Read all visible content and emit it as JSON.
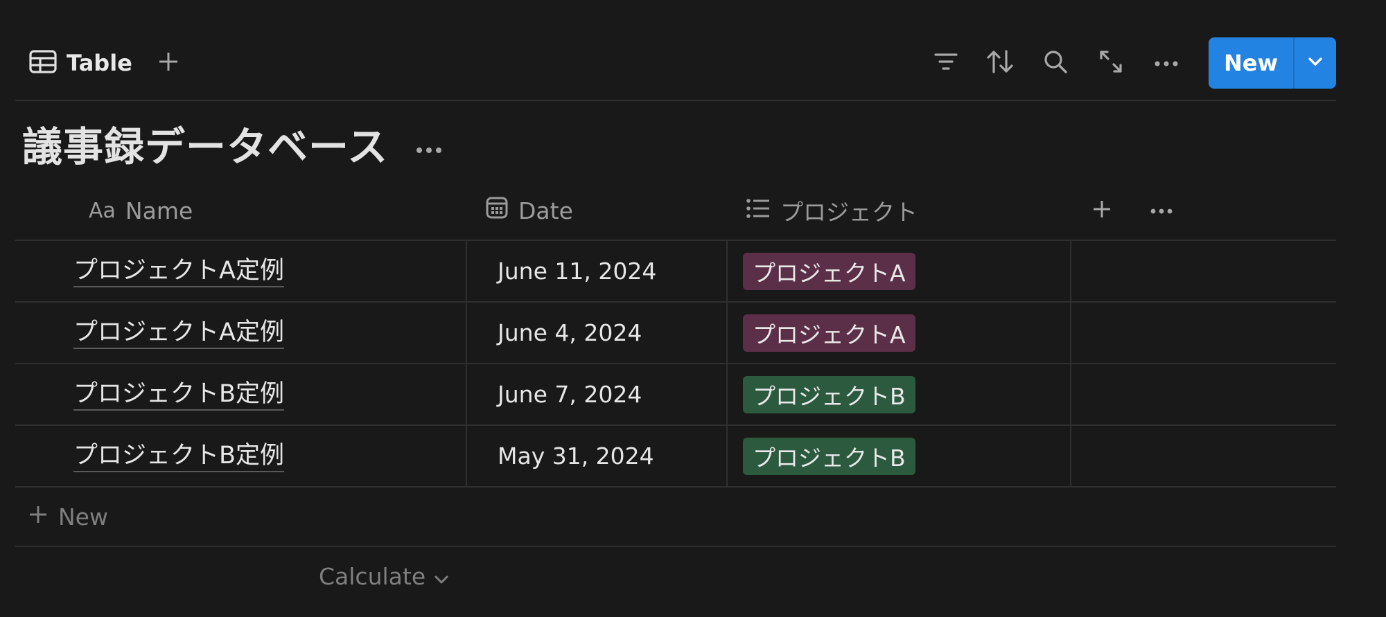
{
  "toolbar": {
    "view_tab_label": "Table",
    "new_button_label": "New"
  },
  "database": {
    "title": "議事録データベース"
  },
  "table": {
    "columns": {
      "name": {
        "prefix": "Aa",
        "label": "Name"
      },
      "date": {
        "label": "Date"
      },
      "project": {
        "label": "プロジェクト"
      }
    },
    "rows": [
      {
        "name": "プロジェクトA定例",
        "date": "June 11, 2024",
        "project": "プロジェクトA"
      },
      {
        "name": "プロジェクトA定例",
        "date": "June 4, 2024",
        "project": "プロジェクトA"
      },
      {
        "name": "プロジェクトB定例",
        "date": "June 7, 2024",
        "project": "プロジェクトB"
      },
      {
        "name": "プロジェクトB定例",
        "date": "May 31, 2024",
        "project": "プロジェクトB"
      }
    ],
    "add_row_label": "New",
    "calculate_label": "Calculate"
  },
  "colors": {
    "background": "#191919",
    "accent": "#2383e2",
    "tag_project_a": "#5c2f48",
    "tag_project_b": "#2b5a3e",
    "border": "#2f2f2f"
  },
  "icons": {
    "view": "table-icon",
    "add_view": "plus-icon",
    "filter": "filter-icon",
    "sort": "sort-icon",
    "search": "search-icon",
    "expand": "expand-icon",
    "more": "more-icon",
    "dropdown": "chevron-down-icon",
    "date_column": "calendar-icon",
    "project_column": "list-icon"
  }
}
